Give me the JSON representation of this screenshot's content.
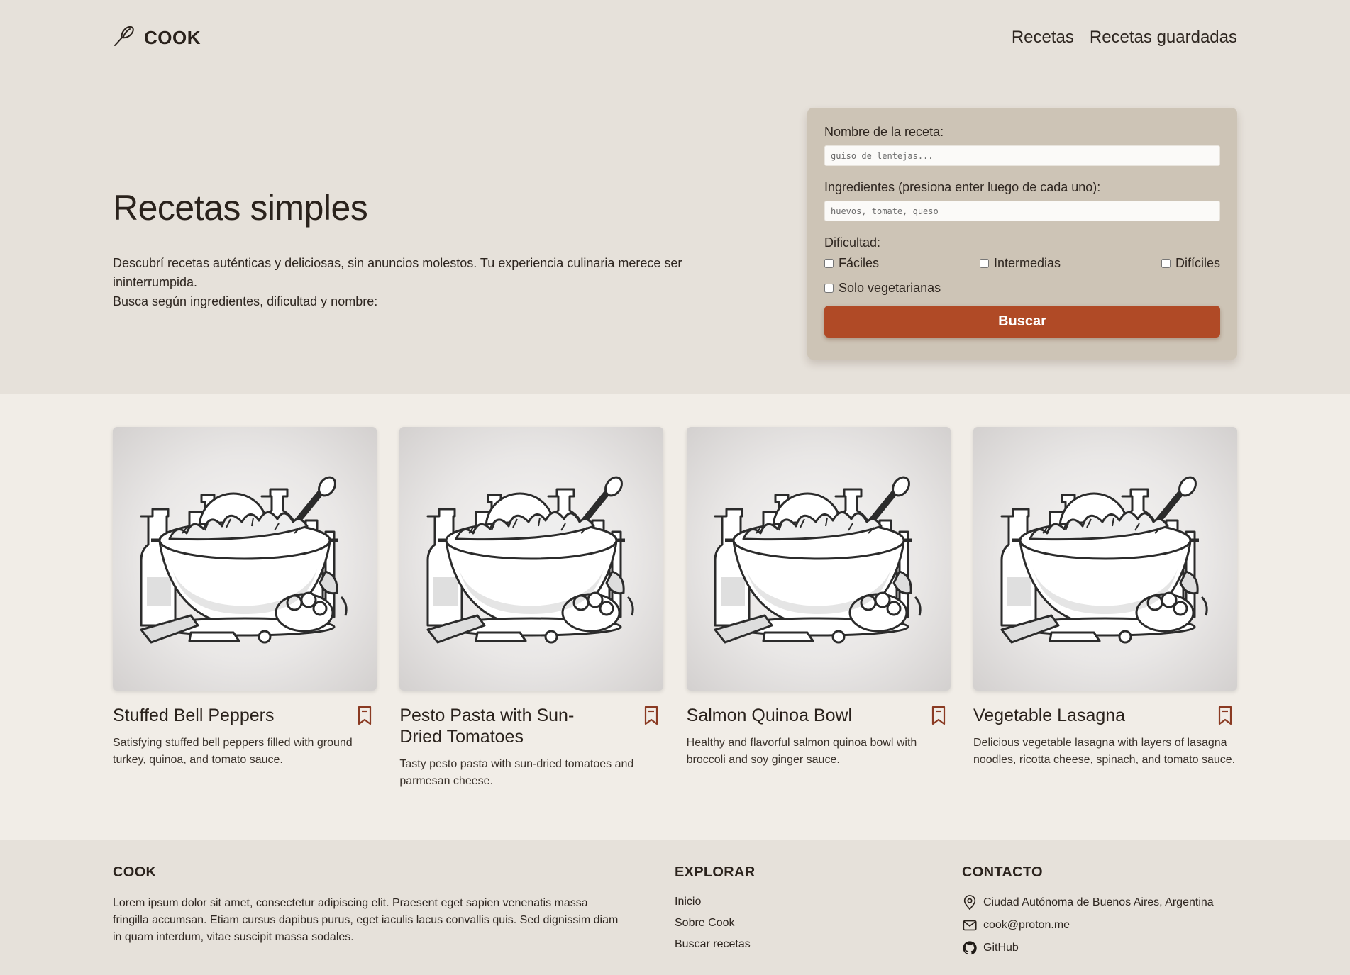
{
  "brand": {
    "name": "COOK"
  },
  "nav": {
    "items": [
      {
        "label": "Recetas"
      },
      {
        "label": "Recetas guardadas"
      }
    ]
  },
  "hero": {
    "title": "Recetas simples",
    "description_line1": "Descubrí recetas auténticas y deliciosas, sin anuncios molestos. Tu experiencia culinaria merece ser ininterrumpida.",
    "description_line2": "Busca según ingredientes, dificultad y nombre:"
  },
  "search": {
    "name_label": "Nombre de la receta:",
    "name_placeholder": "guiso de lentejas...",
    "ingredients_label": "Ingredientes (presiona enter luego de cada uno):",
    "ingredients_placeholder": "huevos, tomate, queso",
    "difficulty_label": "Dificultad:",
    "options": {
      "easy": "Fáciles",
      "medium": "Intermedias",
      "hard": "Difíciles",
      "veg": "Solo vegetarianas"
    },
    "button_label": "Buscar"
  },
  "cards": [
    {
      "title": "Stuffed Bell Peppers",
      "description": "Satisfying stuffed bell peppers filled with ground turkey, quinoa, and tomato sauce."
    },
    {
      "title": "Pesto Pasta with Sun-Dried Tomatoes",
      "description": "Tasty pesto pasta with sun-dried tomatoes and parmesan cheese."
    },
    {
      "title": "Salmon Quinoa Bowl",
      "description": "Healthy and flavorful salmon quinoa bowl with broccoli and soy ginger sauce."
    },
    {
      "title": "Vegetable Lasagna",
      "description": "Delicious vegetable lasagna with layers of lasagna noodles, ricotta cheese, spinach, and tomato sauce."
    }
  ],
  "footer": {
    "about_heading": "COOK",
    "about_text": "Lorem ipsum dolor sit amet, consectetur adipiscing elit. Praesent eget sapien venenatis massa fringilla accumsan. Etiam cursus dapibus purus, eget iaculis lacus convallis quis. Sed dignissim diam in quam interdum, vitae suscipit massa sodales.",
    "explore_heading": "EXPLORAR",
    "explore_links": [
      {
        "label": "Inicio"
      },
      {
        "label": "Sobre Cook"
      },
      {
        "label": "Buscar recetas"
      }
    ],
    "contact_heading": "CONTACTO",
    "contact": {
      "location": "Ciudad Autónoma de Buenos Aires, Argentina",
      "email": "cook@proton.me",
      "github": "GitHub"
    }
  },
  "colors": {
    "accent": "#b04a26",
    "hero_bg": "#e6e1da",
    "body_bg": "#f1ede7",
    "card_panel": "#cdc4b6"
  },
  "icons": {
    "logo": "whisk-icon",
    "bookmark": "bookmark-icon",
    "location": "location-pin-icon",
    "email": "mail-icon",
    "github": "github-icon"
  }
}
